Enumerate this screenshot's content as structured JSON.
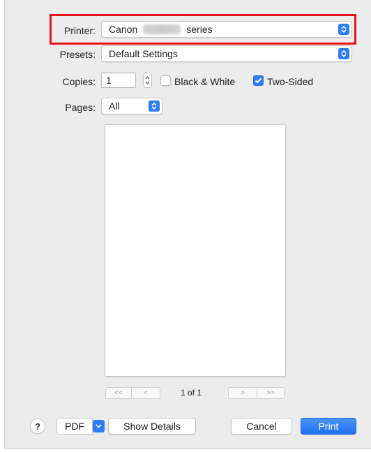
{
  "printer": {
    "label": "Printer:",
    "value_prefix": "Canon",
    "value_suffix": "series"
  },
  "presets": {
    "label": "Presets:",
    "value": "Default Settings"
  },
  "copies": {
    "label": "Copies:",
    "value": "1"
  },
  "black_white": {
    "label": "Black & White",
    "checked": false
  },
  "two_sided": {
    "label": "Two-Sided",
    "checked": true
  },
  "pages": {
    "label": "Pages:",
    "value": "All"
  },
  "pager": {
    "first": "<<",
    "prev": "<",
    "count": "1 of 1",
    "next": ">",
    "last": ">>"
  },
  "footer": {
    "help": "?",
    "pdf": "PDF",
    "show_details": "Show Details",
    "cancel": "Cancel",
    "print": "Print"
  },
  "colors": {
    "accent": "#2f7df6",
    "highlight": "#e8141b",
    "dialog_bg": "#ececec"
  },
  "icons": {
    "popup": "updown-chevron-icon",
    "stepper": "stepper-arrows-icon",
    "check": "checkmark-icon",
    "pdf_menu": "chevron-down-icon"
  }
}
